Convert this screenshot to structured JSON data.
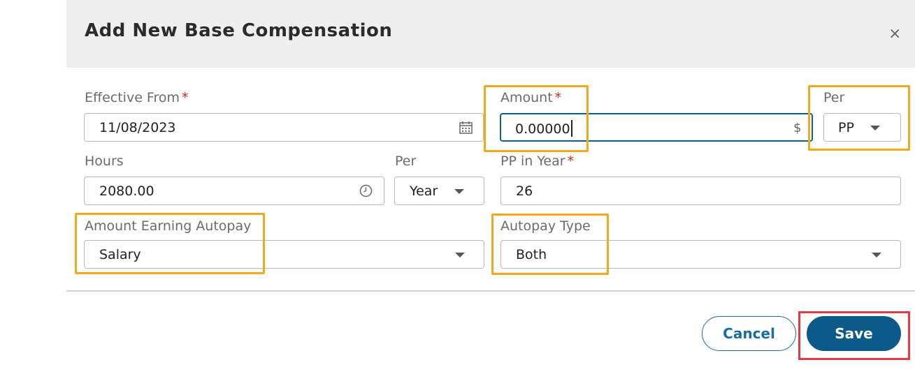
{
  "dialog": {
    "title": "Add New Base Compensation",
    "close_icon": "×"
  },
  "form": {
    "effective_from": {
      "label": "Effective From",
      "required_mark": "*",
      "value": "11/08/2023",
      "icon": "calendar-icon"
    },
    "amount": {
      "label": "Amount",
      "required_mark": "*",
      "value": "0.00000",
      "suffix": "$"
    },
    "amount_per": {
      "label": "Per",
      "value": "PP"
    },
    "hours": {
      "label": "Hours",
      "value": "2080.00",
      "icon": "clock-icon"
    },
    "hours_per": {
      "label": "Per",
      "value": "Year"
    },
    "pp_in_year": {
      "label": "PP in Year",
      "required_mark": "*",
      "value": "26"
    },
    "amount_earning_autopay": {
      "label": "Amount Earning Autopay",
      "value": "Salary"
    },
    "autopay_type": {
      "label": "Autopay Type",
      "value": "Both"
    }
  },
  "footer": {
    "cancel_label": "Cancel",
    "save_label": "Save"
  },
  "colors": {
    "primary": "#0c5a8a",
    "required": "#c62828",
    "highlight_orange": "#f2a81d",
    "highlight_red": "#e63946",
    "header_bg": "#efefef"
  }
}
